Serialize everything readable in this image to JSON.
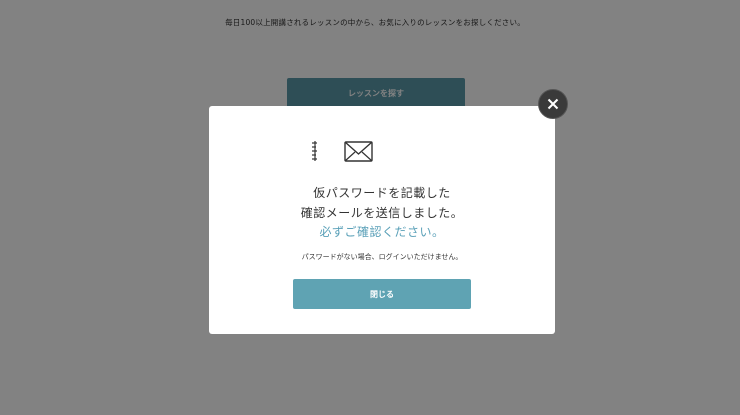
{
  "background": {
    "intro_text": "毎日100以上開講されるレッスンの中から、お気に入りのレッスンをお探しください。",
    "search_button_label": "レッスンを探す"
  },
  "modal": {
    "message_line1": "仮パスワードを記載した",
    "message_line2": "確認メールを送信しました。",
    "message_line3": "必ずご確認ください。",
    "note": "パスワードがない場合、ログインいただけません。",
    "close_label": "閉じる",
    "icons": [
      "speed-lines-icon",
      "mail-icon",
      "close-icon"
    ]
  },
  "colors": {
    "accent": "#5fa3b3",
    "highlight_text": "#5aa0b8",
    "overlay": "#000000"
  }
}
